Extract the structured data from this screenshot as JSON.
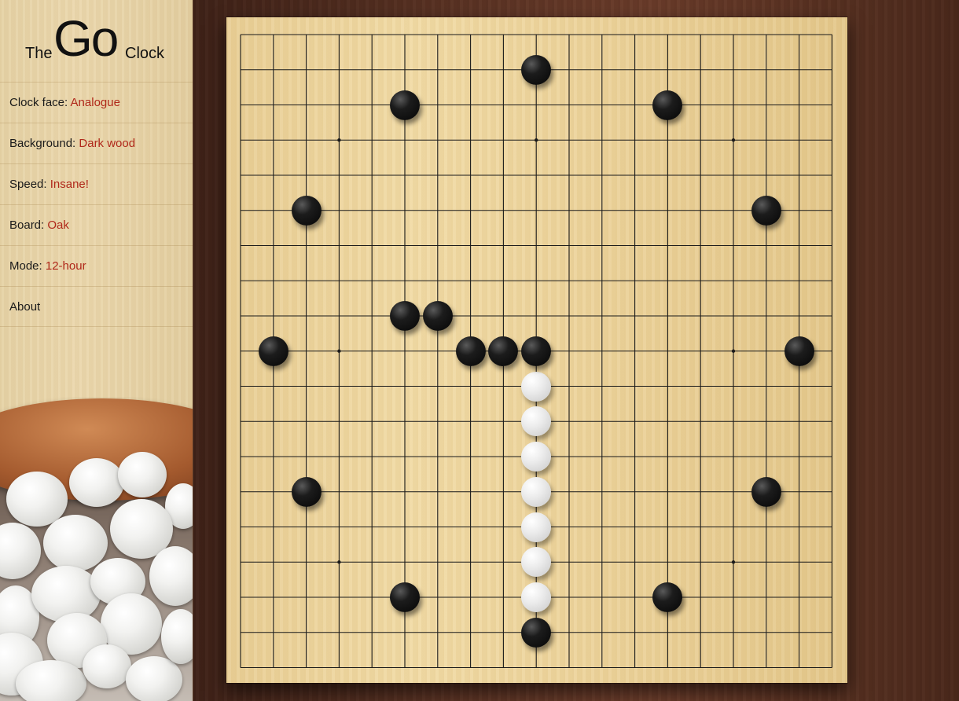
{
  "logo": {
    "the": "The",
    "go": "Go",
    "clock": "Clock"
  },
  "menu": [
    {
      "label": "Clock face: ",
      "value": "Analogue"
    },
    {
      "label": "Background: ",
      "value": "Dark wood"
    },
    {
      "label": "Speed: ",
      "value": "Insane!"
    },
    {
      "label": "Board: ",
      "value": "Oak"
    },
    {
      "label": "Mode: ",
      "value": "12-hour"
    },
    {
      "label": "About",
      "value": ""
    }
  ],
  "board": {
    "size": 19,
    "star_points": [
      [
        3,
        3
      ],
      [
        9,
        3
      ],
      [
        15,
        3
      ],
      [
        3,
        9
      ],
      [
        9,
        9
      ],
      [
        15,
        9
      ],
      [
        3,
        15
      ],
      [
        9,
        15
      ],
      [
        15,
        15
      ]
    ],
    "black_stones": [
      [
        9,
        1
      ],
      [
        5,
        2
      ],
      [
        13,
        2
      ],
      [
        2,
        5
      ],
      [
        16,
        5
      ],
      [
        5,
        8
      ],
      [
        6,
        8
      ],
      [
        1,
        9
      ],
      [
        7,
        9
      ],
      [
        8,
        9
      ],
      [
        9,
        9
      ],
      [
        17,
        9
      ],
      [
        2,
        13
      ],
      [
        16,
        13
      ],
      [
        5,
        16
      ],
      [
        13,
        16
      ],
      [
        9,
        17
      ]
    ],
    "white_stones": [
      [
        9,
        10
      ],
      [
        9,
        11
      ],
      [
        9,
        12
      ],
      [
        9,
        13
      ],
      [
        9,
        14
      ],
      [
        9,
        15
      ],
      [
        9,
        16
      ]
    ]
  },
  "colors": {
    "menu_value": "#b0281a",
    "board": "#ecd39b",
    "background": "#5b3324"
  }
}
